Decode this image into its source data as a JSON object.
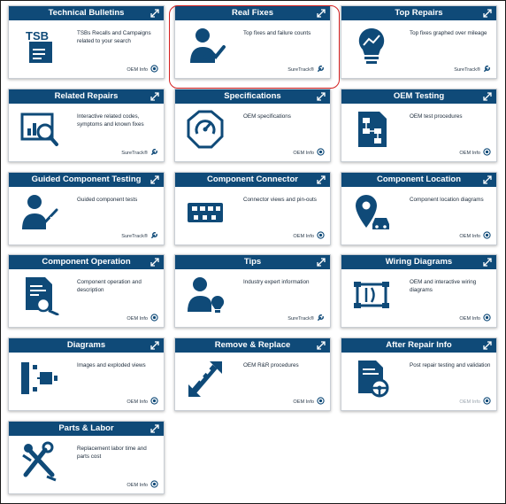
{
  "colors": {
    "header": "#0f4a78",
    "icon": "#0f4a78",
    "highlight": "#d42020",
    "text": "#1b2a3a"
  },
  "cards": [
    {
      "title": "Technical Bulletins",
      "desc": "TSBs Recalls and Campaigns related to your search",
      "source": "OEM Info",
      "icon": "tsb-document-icon",
      "source_icon": "info-circle-icon"
    },
    {
      "title": "Real Fixes",
      "desc": "Top fixes and failure counts",
      "source": "SureTrack®",
      "icon": "technician-wrench-icon",
      "source_icon": "suretrack-icon",
      "highlighted": true
    },
    {
      "title": "Top Repairs",
      "desc": "Top fixes graphed over mileage",
      "source": "SureTrack®",
      "icon": "lightbulb-graph-icon",
      "source_icon": "suretrack-icon"
    },
    {
      "title": "Related Repairs",
      "desc": "Interactive related codes, symptoms and known fixes",
      "source": "SureTrack®",
      "icon": "chart-magnifier-icon",
      "source_icon": "suretrack-icon"
    },
    {
      "title": "Specifications",
      "desc": "OEM specifications",
      "source": "OEM Info",
      "icon": "gauge-octagon-icon",
      "source_icon": "info-circle-icon"
    },
    {
      "title": "OEM Testing",
      "desc": "OEM test procedures",
      "source": "OEM Info",
      "icon": "flowchart-document-icon",
      "source_icon": "info-circle-icon"
    },
    {
      "title": "Guided Component Testing",
      "desc": "Guided component tests",
      "source": "SureTrack®",
      "icon": "technician-probe-icon",
      "source_icon": "suretrack-icon"
    },
    {
      "title": "Component Connector",
      "desc": "Connector views and pin-outs",
      "source": "OEM Info",
      "icon": "connector-icon",
      "source_icon": "info-circle-icon"
    },
    {
      "title": "Component Location",
      "desc": "Component location diagrams",
      "source": "OEM Info",
      "icon": "map-pin-car-icon",
      "source_icon": "info-circle-icon"
    },
    {
      "title": "Component Operation",
      "desc": "Component operation and description",
      "source": "OEM Info",
      "icon": "document-gear-icon",
      "source_icon": "info-circle-icon"
    },
    {
      "title": "Tips",
      "desc": "Industry expert information",
      "source": "SureTrack®",
      "icon": "person-lightbulb-icon",
      "source_icon": "suretrack-icon"
    },
    {
      "title": "Wiring Diagrams",
      "desc": "OEM and interactive wiring diagrams",
      "source": "OEM Info",
      "icon": "wiring-icon",
      "source_icon": "info-circle-icon"
    },
    {
      "title": "Diagrams",
      "desc": "Images and exploded views",
      "source": "OEM Info",
      "icon": "exploded-view-icon",
      "source_icon": "info-circle-icon"
    },
    {
      "title": "Remove & Replace",
      "desc": "OEM R&R procedures",
      "source": "OEM Info",
      "icon": "remove-replace-arrows-icon",
      "source_icon": "info-circle-icon"
    },
    {
      "title": "After Repair Info",
      "desc": "Post repair testing and validation",
      "source": "OEM Info",
      "icon": "document-steering-wheel-icon",
      "source_icon": "info-circle-icon",
      "disabled": true
    },
    {
      "title": "Parts & Labor",
      "desc": "Replacement labor time and parts cost",
      "source": "OEM Info",
      "icon": "tools-icon",
      "source_icon": "info-circle-icon"
    }
  ]
}
